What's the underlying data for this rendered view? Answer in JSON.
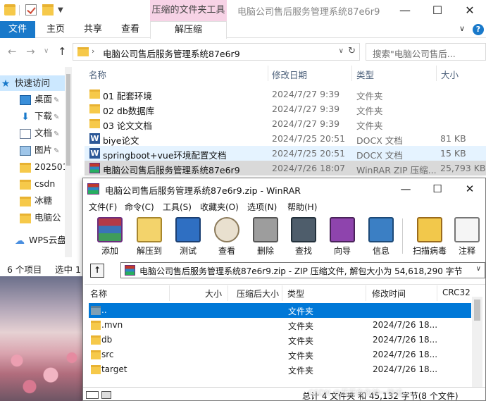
{
  "explorer": {
    "context_tab_group": "压缩的文件夹工具",
    "window_title": "电脑公司售后服务管理系统87e6r9",
    "controls": {
      "minimize": "—",
      "maximize": "☐",
      "close": "✕"
    },
    "tabs": {
      "file": "文件",
      "home": "主页",
      "share": "共享",
      "view": "查看",
      "extract": "解压缩"
    },
    "ribbon_collapse": "∨",
    "help": "?",
    "nav": {
      "back": "←",
      "forward": "→",
      "recent": "∨",
      "up": "↑"
    },
    "address": "电脑公司售后服务管理系统87e6r9",
    "search_placeholder": "搜索\"电脑公司售后...",
    "columns": {
      "name": "名称",
      "date": "修改日期",
      "type": "类型",
      "size": "大小"
    },
    "sidebar": [
      {
        "label": "快速访问",
        "icon": "star-icon"
      },
      {
        "label": "桌面",
        "icon": "desktop-icon",
        "pinned": true
      },
      {
        "label": "下载",
        "icon": "download-icon",
        "pinned": true
      },
      {
        "label": "文档",
        "icon": "documents-icon",
        "pinned": true
      },
      {
        "label": "图片",
        "icon": "pictures-icon",
        "pinned": true
      },
      {
        "label": "202501",
        "icon": "folder-icon"
      },
      {
        "label": "csdn",
        "icon": "folder-icon"
      },
      {
        "label": "冰糖",
        "icon": "folder-icon"
      },
      {
        "label": "电脑公",
        "icon": "folder-icon"
      },
      {
        "label": "WPS云盘",
        "icon": "cloud-icon"
      }
    ],
    "pin_glyph": "✎",
    "files": [
      {
        "name": "01 配套环境",
        "date": "2024/7/27 9:39",
        "type": "文件夹",
        "size": "",
        "kind": "folder"
      },
      {
        "name": "02 db数据库",
        "date": "2024/7/27 9:39",
        "type": "文件夹",
        "size": "",
        "kind": "folder"
      },
      {
        "name": "03 论文文档",
        "date": "2024/7/27 9:39",
        "type": "文件夹",
        "size": "",
        "kind": "folder"
      },
      {
        "name": "biye论文",
        "date": "2024/7/25 20:51",
        "type": "DOCX 文档",
        "size": "81 KB",
        "kind": "word"
      },
      {
        "name": "springboot+vue环境配置文档",
        "date": "2024/7/25 20:51",
        "type": "DOCX 文档",
        "size": "15 KB",
        "kind": "word"
      },
      {
        "name": "电脑公司售后服务管理系统87e6r9",
        "date": "2024/7/26 18:07",
        "type": "WinRAR ZIP 压缩...",
        "size": "25,793 KB",
        "kind": "rar"
      }
    ],
    "status_count": "6 个项目",
    "status_selected": "选中 1"
  },
  "winrar": {
    "title": "电脑公司售后服务管理系统87e6r9.zip - WinRAR",
    "controls": {
      "minimize": "—",
      "maximize": "☐",
      "close": "✕"
    },
    "menu": [
      "文件(F)",
      "命令(C)",
      "工具(S)",
      "收藏夹(O)",
      "选项(N)",
      "帮助(H)"
    ],
    "toolbar": [
      {
        "label": "添加",
        "icon": "add-archive-icon"
      },
      {
        "label": "解压到",
        "icon": "extract-to-icon"
      },
      {
        "label": "测试",
        "icon": "test-icon"
      },
      {
        "label": "查看",
        "icon": "view-icon"
      },
      {
        "label": "删除",
        "icon": "delete-icon"
      },
      {
        "label": "查找",
        "icon": "find-icon"
      },
      {
        "label": "向导",
        "icon": "wizard-icon"
      },
      {
        "label": "信息",
        "icon": "info-icon"
      },
      {
        "label": "扫描病毒",
        "icon": "virus-scan-icon"
      },
      {
        "label": "注释",
        "icon": "comment-icon"
      }
    ],
    "up_glyph": "↑",
    "path": "电脑公司售后服务管理系统87e6r9.zip - ZIP 压缩文件, 解包大小为 54,618,290 字节",
    "columns": {
      "name": "名称",
      "size": "大小",
      "packed": "压缩后大小",
      "type": "类型",
      "modified": "修改时间",
      "crc": "CRC32"
    },
    "rows": [
      {
        "name": "..",
        "type": "文件夹",
        "modified": ""
      },
      {
        "name": ".mvn",
        "type": "文件夹",
        "modified": "2024/7/26 18..."
      },
      {
        "name": "db",
        "type": "文件夹",
        "modified": "2024/7/26 18..."
      },
      {
        "name": "src",
        "type": "文件夹",
        "modified": "2024/7/26 18..."
      },
      {
        "name": "target",
        "type": "文件夹",
        "modified": "2024/7/26 18..."
      }
    ],
    "status": "总计 4 文件夹 和 45,132 字节(8 个文件)",
    "watermark": "CSDN @菲菲伤伤神一毕设"
  }
}
